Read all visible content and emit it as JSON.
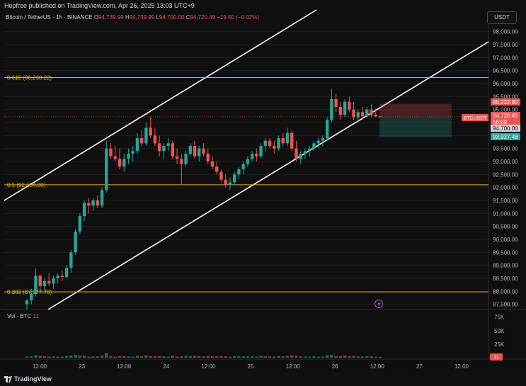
{
  "header": {
    "publisher": "Hopfree published on TradingView.com, Apr 26, 2025 13:03 UTC+9",
    "symbol": "Bitcoin / TetherUS · 1h · BINANCE",
    "ohlc": [
      {
        "k": "O",
        "v": "94,739.99"
      },
      {
        "k": "H",
        "v": "94,739.99"
      },
      {
        "k": "L",
        "v": "94,700.00"
      },
      {
        "k": "C",
        "v": "94,720.49"
      }
    ],
    "change": "−19.50 (−0.02%)",
    "currency_button": "USDT"
  },
  "volume_legend": {
    "label": "Vol · BTC",
    "value": "11"
  },
  "footer": {
    "brand": "TradingView"
  },
  "colors": {
    "up": "#26a69a",
    "down": "#ef5350",
    "fib": "#f0b400",
    "channel": "#ffffff",
    "background": "#0f0f0f",
    "grid": "#1e1e1e",
    "text": "#b2b5be"
  },
  "chart_data": {
    "type": "candlestick",
    "ylim": [
      87300,
      98400
    ],
    "y_ticks": [
      "98,000.00",
      "97,500.00",
      "97,000.00",
      "96,500.00",
      "96,000.00",
      "95,500.00",
      "95,000.00",
      "94,500.00",
      "94,000.00",
      "93,500.00",
      "93,000.00",
      "92,500.00",
      "92,000.00",
      "91,500.00",
      "91,000.00",
      "90,500.00",
      "90,000.00",
      "89,500.00",
      "89,000.00",
      "88,500.00",
      "88,000.00",
      "87,500.00"
    ],
    "x_ticks": [
      "12:00",
      "23",
      "12:00",
      "24",
      "12:00",
      "25",
      "12:00",
      "26",
      "12:00",
      "27",
      "12:00"
    ],
    "fib_levels": [
      {
        "label": "0.618 (96,230.22)",
        "value": 96230.22
      },
      {
        "label": "0.5 (92,104.00)",
        "value": 92104.0
      },
      {
        "label": "0.382 (87,977.78)",
        "value": 87977.78
      }
    ],
    "price_labels": [
      {
        "text": "95,222.80",
        "value": 95222.8,
        "color": "#ef5350"
      },
      {
        "text": "BTCUSDT",
        "value": 94720.49,
        "color": "#ef5350"
      },
      {
        "text": "94,720.49",
        "value": 94720.49,
        "color": "#ef5350"
      },
      {
        "text": "56:09",
        "value": 94530,
        "color": "#ef5350"
      },
      {
        "text": "94,700.00",
        "value": 94700.0,
        "color": "#d1d4dc"
      },
      {
        "text": "93,927.48",
        "value": 93927.48,
        "color": "#26a69a"
      }
    ],
    "volume_ticks": [
      "75K",
      "50K",
      "25K"
    ],
    "volume_badge": "11",
    "candles": [
      [
        87500,
        87700,
        87300,
        87650
      ],
      [
        87650,
        88100,
        87500,
        87900
      ],
      [
        87900,
        88900,
        87800,
        88600
      ],
      [
        88600,
        88650,
        88000,
        88200
      ],
      [
        88200,
        88500,
        88000,
        88400
      ],
      [
        88400,
        88700,
        88200,
        88300
      ],
      [
        88300,
        88600,
        88100,
        88500
      ],
      [
        88500,
        88700,
        88300,
        88600
      ],
      [
        88600,
        88800,
        88400,
        88550
      ],
      [
        88550,
        89000,
        88500,
        88900
      ],
      [
        88900,
        89600,
        88700,
        89500
      ],
      [
        89500,
        90400,
        89400,
        90300
      ],
      [
        90300,
        91000,
        90200,
        90900
      ],
      [
        90900,
        91500,
        90700,
        91400
      ],
      [
        91400,
        91600,
        91000,
        91300
      ],
      [
        91300,
        91600,
        91100,
        91500
      ],
      [
        91500,
        91700,
        91200,
        91300
      ],
      [
        91300,
        92000,
        91200,
        91900
      ],
      [
        91900,
        93800,
        91800,
        93500
      ],
      [
        93500,
        93700,
        93100,
        93200
      ],
      [
        93200,
        93600,
        93000,
        93100
      ],
      [
        93100,
        93500,
        92700,
        92800
      ],
      [
        92800,
        93300,
        92600,
        93100
      ],
      [
        93100,
        93500,
        92900,
        93300
      ],
      [
        93300,
        93600,
        93000,
        93400
      ],
      [
        93400,
        94100,
        93300,
        93900
      ],
      [
        93900,
        94200,
        93600,
        93700
      ],
      [
        93700,
        94500,
        93600,
        94300
      ],
      [
        94300,
        94700,
        93900,
        94000
      ],
      [
        94000,
        94300,
        93600,
        93700
      ],
      [
        93700,
        94000,
        93200,
        93400
      ],
      [
        93400,
        93700,
        93100,
        93600
      ],
      [
        93600,
        93900,
        93400,
        93700
      ],
      [
        93700,
        93800,
        93100,
        93200
      ],
      [
        93200,
        93500,
        92900,
        93100
      ],
      [
        93100,
        93300,
        92100,
        92900
      ],
      [
        92900,
        93400,
        92800,
        93300
      ],
      [
        93300,
        93700,
        93200,
        93600
      ],
      [
        93600,
        93800,
        93100,
        93200
      ],
      [
        93200,
        93600,
        93000,
        93500
      ],
      [
        93500,
        93700,
        93200,
        93300
      ],
      [
        93300,
        93500,
        92900,
        93000
      ],
      [
        93000,
        93200,
        92700,
        92800
      ],
      [
        92800,
        93000,
        92500,
        92600
      ],
      [
        92600,
        92700,
        92200,
        92300
      ],
      [
        92300,
        92500,
        92000,
        92100
      ],
      [
        92100,
        92400,
        91900,
        92200
      ],
      [
        92200,
        92600,
        92100,
        92500
      ],
      [
        92500,
        92800,
        92300,
        92700
      ],
      [
        92700,
        93000,
        92500,
        92900
      ],
      [
        92900,
        93200,
        92800,
        93100
      ],
      [
        93100,
        93400,
        93000,
        93300
      ],
      [
        93300,
        93500,
        93000,
        93200
      ],
      [
        93200,
        93700,
        93100,
        93600
      ],
      [
        93600,
        93900,
        93400,
        93800
      ],
      [
        93800,
        93900,
        93500,
        93600
      ],
      [
        93600,
        93800,
        93300,
        93500
      ],
      [
        93500,
        94000,
        93400,
        93900
      ],
      [
        93900,
        94100,
        93600,
        93700
      ],
      [
        93700,
        94300,
        93600,
        94100
      ],
      [
        94100,
        94200,
        93400,
        93500
      ],
      [
        93500,
        93800,
        93000,
        93100
      ],
      [
        93100,
        93400,
        92900,
        93300
      ],
      [
        93300,
        93500,
        93100,
        93400
      ],
      [
        93400,
        93600,
        93200,
        93500
      ],
      [
        93500,
        93800,
        93400,
        93700
      ],
      [
        93700,
        93900,
        93500,
        93800
      ],
      [
        93800,
        94000,
        93600,
        93900
      ],
      [
        93900,
        94700,
        93800,
        94600
      ],
      [
        94600,
        95800,
        94500,
        95400
      ],
      [
        95400,
        95600,
        94900,
        95100
      ],
      [
        95100,
        95300,
        94600,
        94800
      ],
      [
        94800,
        95400,
        94700,
        95300
      ],
      [
        95300,
        95500,
        94900,
        95000
      ],
      [
        95000,
        95300,
        94600,
        94700
      ],
      [
        94700,
        95000,
        94500,
        94900
      ],
      [
        94900,
        95100,
        94600,
        94750
      ],
      [
        94750,
        95100,
        94700,
        95000
      ],
      [
        95000,
        95200,
        94700,
        94800
      ],
      [
        94800,
        95050,
        94700,
        94740
      ],
      [
        94740,
        94740,
        94700,
        94720
      ]
    ]
  }
}
